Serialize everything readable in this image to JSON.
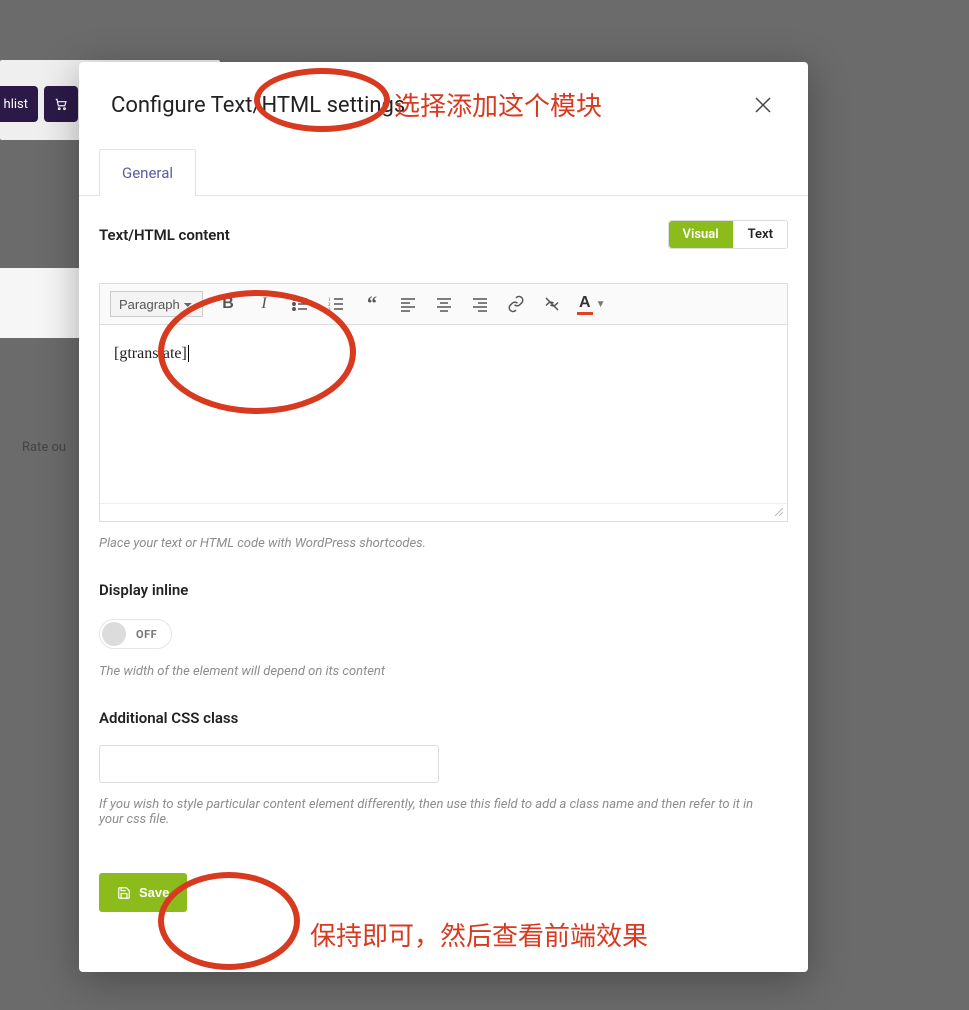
{
  "bg": {
    "wishlist_label": "hlist",
    "rate_text": "Rate ou"
  },
  "modal": {
    "title": "Configure Text/HTML settings",
    "tab_general": "General",
    "content_label": "Text/HTML content",
    "visual_label": "Visual",
    "text_label": "Text",
    "format_option": "Paragraph",
    "editor_content": "[gtranslate]",
    "content_hint": "Place your text or HTML code with WordPress shortcodes.",
    "inline_label": "Display inline",
    "toggle_state": "OFF",
    "inline_hint": "The width of the element will depend on its content",
    "css_label": "Additional CSS class",
    "css_value": "",
    "css_hint": "If you wish to style particular content element differently, then use this field to add a class name and then refer to it in your css file.",
    "save_label": "Save"
  },
  "annotations": {
    "top_text": "选择添加这个模块",
    "bottom_text": "保持即可，然后查看前端效果"
  },
  "colors": {
    "accent_green": "#8bbc1b",
    "annotation_red": "#d83a20"
  }
}
